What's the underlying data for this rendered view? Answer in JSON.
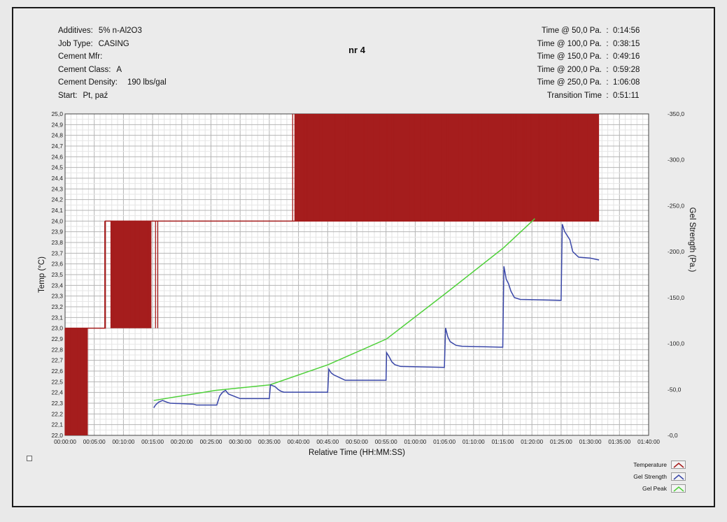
{
  "header": {
    "title": "nr 4",
    "left_rows": [
      {
        "label": "Additives:",
        "value": "5% n-Al2O3"
      },
      {
        "label": "Job Type:",
        "value": "CASING"
      },
      {
        "label": "Cement Mfr:",
        "value": ""
      },
      {
        "label": "Cement Class:",
        "value": "A"
      },
      {
        "label": "Cement Density:",
        "value": "190 lbs/gal"
      },
      {
        "label": "Start:",
        "value": "Pt, paź"
      }
    ],
    "right_rows": [
      {
        "label": "Time @ 50,0 Pa.",
        "value": "0:14:56"
      },
      {
        "label": "Time @ 100,0 Pa.",
        "value": "0:38:15"
      },
      {
        "label": "Time @ 150,0 Pa.",
        "value": "0:49:16"
      },
      {
        "label": "Time @ 200,0 Pa.",
        "value": "0:59:28"
      },
      {
        "label": "Time @ 250,0 Pa.",
        "value": "1:06:08"
      },
      {
        "label": "Transition Time",
        "value": "0:51:11"
      }
    ]
  },
  "legend": [
    {
      "name": "Temperature",
      "color": "#a51d1d"
    },
    {
      "name": "Gel Strength",
      "color": "#3a47a8"
    },
    {
      "name": "Gel Peak",
      "color": "#4fd13a"
    }
  ],
  "chart_data": {
    "type": "line",
    "xlabel": "Relative Time (HH:MM:SS)",
    "ylabel_left": "Temp (°C)",
    "ylabel_right": "Gel Strength (Pa.)",
    "x_unit": "minutes",
    "xlim": [
      0,
      100
    ],
    "x_ticks": [
      "00:00:00",
      "00:05:00",
      "00:10:00",
      "00:15:00",
      "00:20:00",
      "00:25:00",
      "00:30:00",
      "00:35:00",
      "00:40:00",
      "00:45:00",
      "00:50:00",
      "00:55:00",
      "01:00:00",
      "01:05:00",
      "01:10:00",
      "01:15:00",
      "01:20:00",
      "01:25:00",
      "01:30:00",
      "01:35:00",
      "01:40:00"
    ],
    "y_left_lim": [
      22.0,
      25.0
    ],
    "y_left_ticks": [
      "22,0",
      "22,1",
      "22,2",
      "22,3",
      "22,4",
      "22,5",
      "22,6",
      "22,7",
      "22,8",
      "22,9",
      "23,0",
      "23,1",
      "23,2",
      "23,3",
      "23,4",
      "23,5",
      "23,6",
      "23,7",
      "23,8",
      "23,9",
      "24,0",
      "24,1",
      "24,2",
      "24,3",
      "24,4",
      "24,5",
      "24,6",
      "24,7",
      "24,8",
      "24,9",
      "25,0"
    ],
    "y_right_lim": [
      0,
      350
    ],
    "y_right_ticks": [
      {
        "value": 0,
        "label": "-0,0"
      },
      {
        "value": 50,
        "label": "-50,0"
      },
      {
        "value": 100,
        "label": "-100,0"
      },
      {
        "value": 150,
        "label": "-150,0"
      },
      {
        "value": 200,
        "label": "-200,0"
      },
      {
        "value": 250,
        "label": "-250,0"
      },
      {
        "value": 300,
        "label": "-300,0"
      },
      {
        "value": 350,
        "label": "-350,0"
      }
    ],
    "grid": true,
    "series": [
      {
        "name": "Temperature",
        "color": "#a51d1d",
        "axis": "left",
        "base_levels": [
          [
            0,
            23.0
          ],
          [
            6.9,
            23.0
          ],
          [
            6.9,
            24.0
          ],
          [
            15.8,
            24.0
          ],
          [
            15.8,
            24.0
          ],
          [
            91.5,
            24.0
          ]
        ],
        "fill_blocks": [
          [
            0,
            3.9,
            22.0,
            23.0
          ],
          [
            7.8,
            14.8,
            23.0,
            24.0
          ],
          [
            39.3,
            91.5,
            24.0,
            25.0
          ]
        ],
        "oscillation_spans": [
          [
            0,
            4.0,
            22.0,
            23.0
          ],
          [
            6.8,
            15.9,
            23.0,
            24.0
          ],
          [
            39.0,
            91.5,
            24.0,
            25.0
          ]
        ]
      },
      {
        "name": "Gel Strength",
        "color": "#3a47a8",
        "axis": "right",
        "points": [
          [
            15.2,
            30
          ],
          [
            15.5,
            33
          ],
          [
            16,
            36
          ],
          [
            16.7,
            38
          ],
          [
            17.5,
            36
          ],
          [
            18,
            35
          ],
          [
            22,
            34
          ],
          [
            22.5,
            33
          ],
          [
            26,
            33
          ],
          [
            26.5,
            43
          ],
          [
            27,
            47
          ],
          [
            27.5,
            49
          ],
          [
            28,
            45
          ],
          [
            30,
            40
          ],
          [
            35,
            40
          ],
          [
            35.2,
            55
          ],
          [
            36,
            53
          ],
          [
            36.5,
            50
          ],
          [
            37,
            48
          ],
          [
            37.5,
            47
          ],
          [
            45,
            47
          ],
          [
            45.2,
            72
          ],
          [
            45.6,
            68
          ],
          [
            46,
            66
          ],
          [
            47,
            63
          ],
          [
            48,
            60
          ],
          [
            55,
            60
          ],
          [
            55.1,
            90
          ],
          [
            55.5,
            86
          ],
          [
            56,
            80
          ],
          [
            56.5,
            77
          ],
          [
            57.5,
            75
          ],
          [
            65,
            74
          ],
          [
            65.2,
            117
          ],
          [
            65.6,
            107
          ],
          [
            66,
            102
          ],
          [
            67,
            98
          ],
          [
            68,
            97
          ],
          [
            75,
            96
          ],
          [
            75.2,
            184
          ],
          [
            75.6,
            170
          ],
          [
            76,
            165
          ],
          [
            76.4,
            157
          ],
          [
            77,
            150
          ],
          [
            78,
            148
          ],
          [
            85,
            147
          ],
          [
            85.2,
            230
          ],
          [
            85.6,
            222
          ],
          [
            86,
            218
          ],
          [
            86.5,
            213
          ],
          [
            87,
            200
          ],
          [
            88,
            194
          ],
          [
            90,
            193
          ],
          [
            91.5,
            191
          ]
        ]
      },
      {
        "name": "Gel Peak",
        "color": "#4fd13a",
        "axis": "right",
        "points": [
          [
            15.2,
            38
          ],
          [
            25.8,
            49
          ],
          [
            35.1,
            55
          ],
          [
            45.1,
            77
          ],
          [
            55.1,
            105
          ],
          [
            65.1,
            154
          ],
          [
            75.1,
            204
          ],
          [
            80,
            233
          ],
          [
            80.5,
            236
          ]
        ]
      }
    ]
  }
}
